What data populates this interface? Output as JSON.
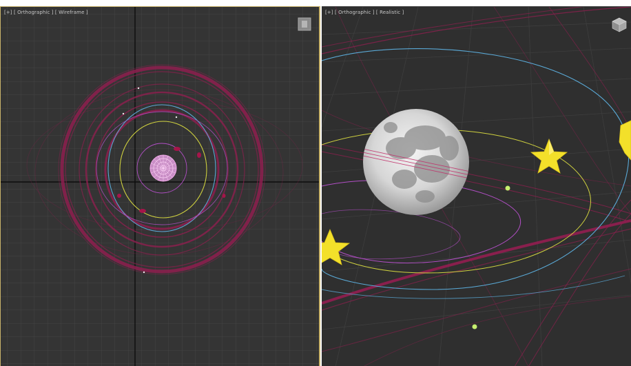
{
  "viewports": {
    "left": {
      "label": "[+] [ Orthographic ] [ Wireframe ]",
      "mode": "wireframe",
      "nav_icon": "viewcube-icon"
    },
    "right": {
      "label": "[+] [ Orthographic ] [ Realistic ]",
      "mode": "realistic",
      "nav_icon": "viewcube-icon"
    }
  },
  "colors": {
    "viewport_bg": "#343434",
    "grid": "#474747",
    "axis": "#0a0a0a",
    "orbit_red": "#8e1f4f",
    "orbit_blue": "#5aa9d6",
    "orbit_yellow": "#cfd13f",
    "orbit_purple": "#b34fc7",
    "star": "#f3e02a",
    "sun_wire": "#f0a8e8",
    "active_border": "#c9b36a"
  }
}
